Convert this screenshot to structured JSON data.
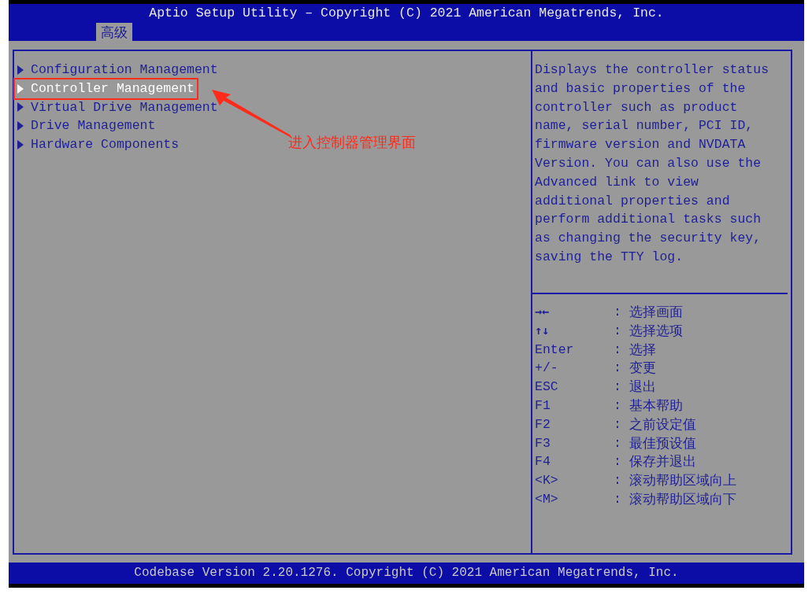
{
  "header": {
    "title": "Aptio Setup Utility – Copyright (C) 2021 American Megatrends, Inc.",
    "tabs": [
      {
        "label": "高级",
        "selected": true
      }
    ]
  },
  "menu": [
    {
      "label": "Configuration Management",
      "selected": false,
      "highlighted": false
    },
    {
      "label": "Controller Management",
      "selected": true,
      "highlighted": true
    },
    {
      "label": "Virtual Drive Management",
      "selected": false,
      "highlighted": false
    },
    {
      "label": "Drive Management",
      "selected": false,
      "highlighted": false
    },
    {
      "label": "Hardware Components",
      "selected": false,
      "highlighted": false
    }
  ],
  "annotation": {
    "text": "进入控制器管理界面"
  },
  "help_text": "Displays the controller status and basic properties of the controller such as product name, serial number, PCI ID, firmware version and NVDATA Version. You can also use the Advanced link to view additional properties and perform additional tasks such as changing the security key, saving the TTY log.",
  "keys": [
    {
      "key": "→←",
      "sep": ":",
      "action": "选择画面",
      "kind": "symbol"
    },
    {
      "key": "↑↓",
      "sep": ":",
      "action": "选择选项",
      "kind": "symbol"
    },
    {
      "key": "Enter",
      "sep": ":",
      "action": "选择",
      "kind": "text"
    },
    {
      "key": "+/-",
      "sep": ":",
      "action": "变更",
      "kind": "text"
    },
    {
      "key": "ESC",
      "sep": ":",
      "action": "退出",
      "kind": "text"
    },
    {
      "key": "F1",
      "sep": ":",
      "action": "基本帮助",
      "kind": "text"
    },
    {
      "key": "F2",
      "sep": ":",
      "action": "之前设定值",
      "kind": "text"
    },
    {
      "key": "F3",
      "sep": ":",
      "action": "最佳预设值",
      "kind": "text"
    },
    {
      "key": "F4",
      "sep": ":",
      "action": "保存并退出",
      "kind": "text"
    },
    {
      "key": "<K>",
      "sep": ":",
      "action": "滚动帮助区域向上",
      "kind": "text"
    },
    {
      "key": "<M>",
      "sep": ":",
      "action": "滚动帮助区域向下",
      "kind": "text"
    }
  ],
  "footer": "Codebase Version 2.20.1276. Copyright (C) 2021 American Megatrends, Inc."
}
